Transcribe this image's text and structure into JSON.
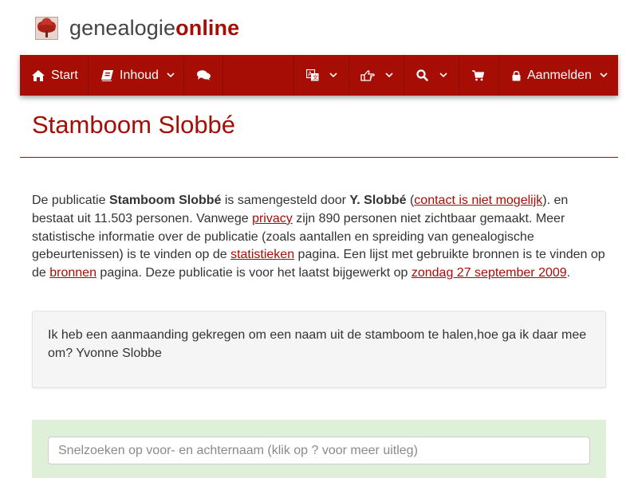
{
  "site": {
    "brand_part1": "genealogie",
    "brand_part2": "online",
    "accent_color": "#a50d05"
  },
  "nav": {
    "start_label": "Start",
    "inhoud_label": "Inhoud",
    "login_label": "Aanmelden",
    "icons": [
      "home-icon",
      "book-icon",
      "comments-icon",
      "language-icon",
      "hand-pointer-icon",
      "search-icon",
      "shopping-cart-icon",
      "lock-icon"
    ]
  },
  "page": {
    "title": "Stamboom Slobbé"
  },
  "intro": {
    "t1": "De publicatie ",
    "pub_name": "Stamboom Slobbé",
    "t2": " is samengesteld door ",
    "author": "Y. Slobbé",
    "t3": " (",
    "contact_link": "contact is niet mogelijk",
    "t4": "). en bestaat uit 11.503 personen. Vanwege ",
    "privacy_link": "privacy",
    "t5": " zijn 890 personen niet zichtbaar gemaakt. Meer statistische informatie over de publicatie (zoals aantallen en spreiding van genealogische gebeurtenissen) is te vinden op de ",
    "stats_link": "statistieken",
    "t6": " pagina. Een lijst met gebruikte bronnen is te vinden op de ",
    "sources_link": "bronnen",
    "t7": " pagina. Deze publicatie is voor het laatst bijgewerkt op ",
    "date_link": "zondag 27 september 2009",
    "t8": "."
  },
  "note": {
    "text": "Ik heb een aanmaanding gekregen om een naam uit de stamboom te halen,hoe ga ik daar mee om? Yvonne Slobbe"
  },
  "search": {
    "placeholder": "Snelzoeken op voor- en achternaam (klik op ? voor meer uitleg)"
  }
}
